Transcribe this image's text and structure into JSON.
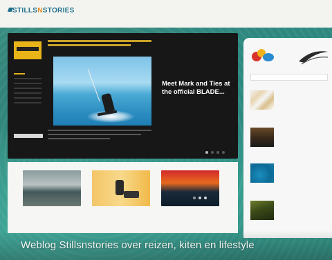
{
  "brand": {
    "logo_text": "STILLS",
    "logo_amp": "N",
    "logo_text2": "STORIES",
    "accent": "#e58b1e",
    "blue": "#1f6f8b"
  },
  "nav": {
    "items": [
      "",
      "",
      "",
      "",
      ""
    ]
  },
  "hero": {
    "title": "Meet Mark and Ties at the official BLADE...",
    "meta": "",
    "excerpt": ""
  },
  "strip": {
    "cards": [
      {
        "caption": ""
      },
      {
        "caption": ""
      },
      {
        "caption": ""
      }
    ]
  },
  "sidebar": {
    "search_placeholder": "",
    "items": [
      {
        "title": "",
        "date": ""
      },
      {
        "title": "",
        "date": ""
      },
      {
        "title": "",
        "date": ""
      },
      {
        "title": "",
        "date": ""
      }
    ]
  },
  "tagline": "Weblog Stillsnstories over reizen, kiten en lifestyle"
}
